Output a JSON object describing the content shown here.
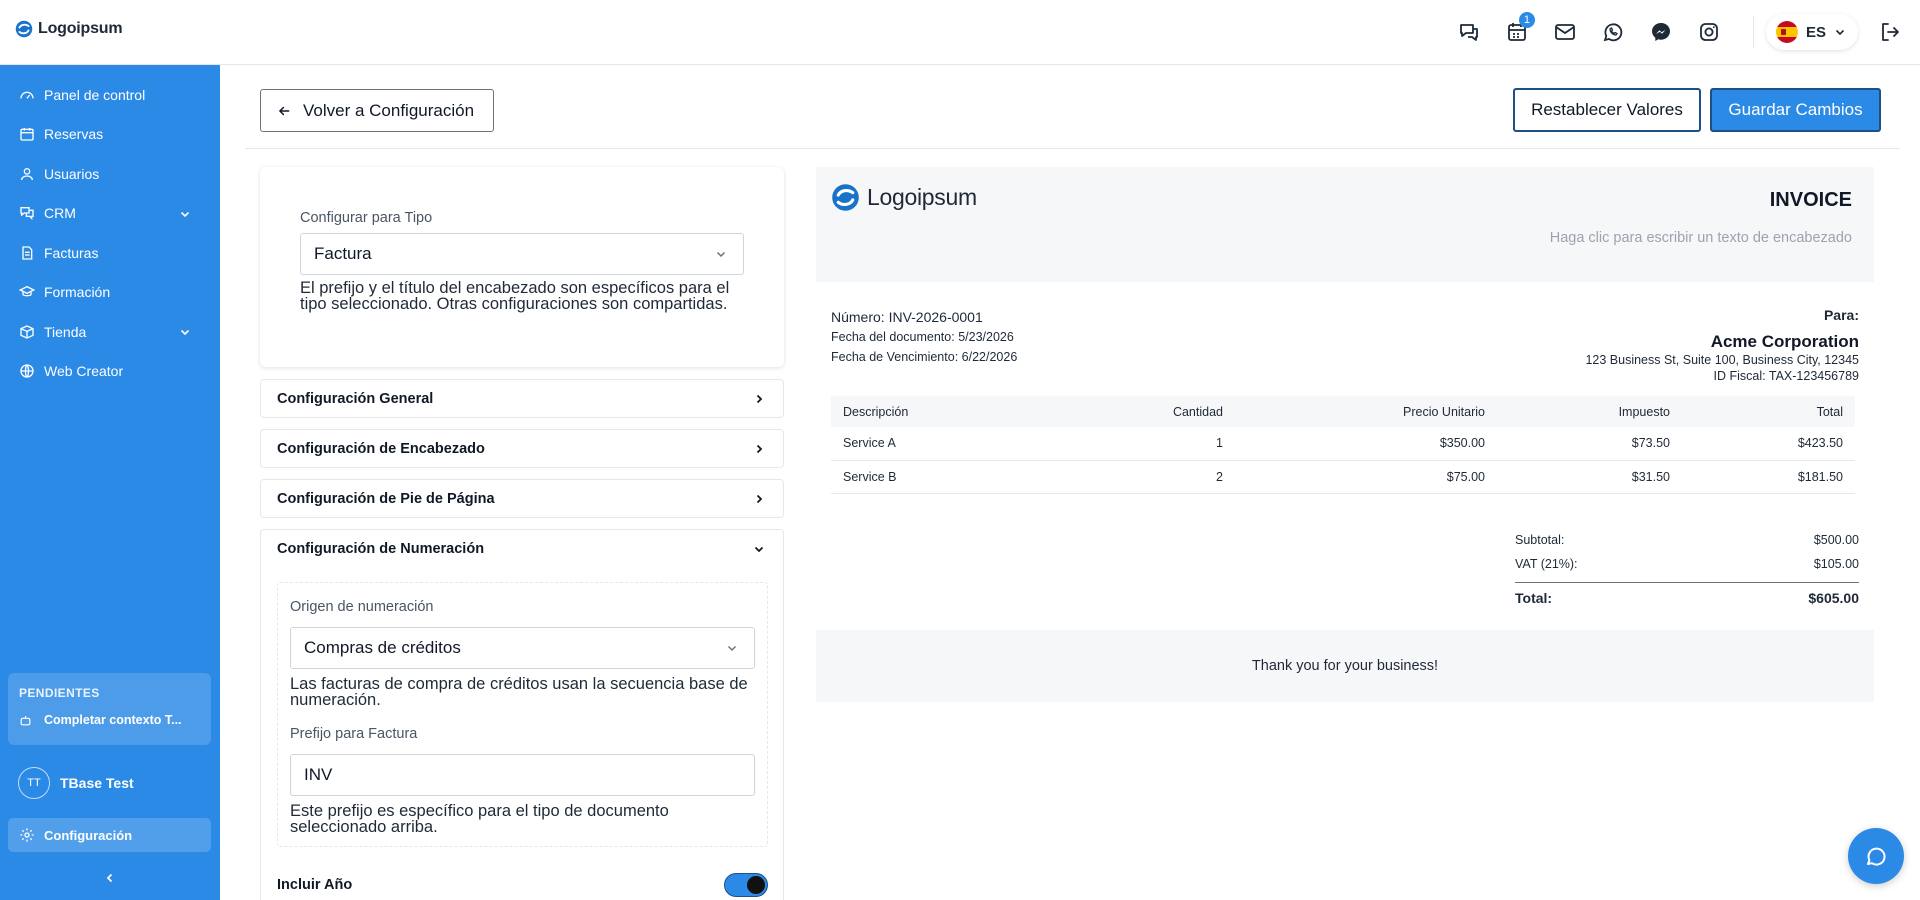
{
  "app": {
    "logo_text": "Logoipsum"
  },
  "topbar": {
    "calendar_badge": "1",
    "language": "ES",
    "icons": [
      "chat-bubbles-icon",
      "calendar-icon",
      "mail-icon",
      "whatsapp-icon",
      "messenger-icon",
      "instagram-icon",
      "logout-icon"
    ]
  },
  "sidebar": {
    "items": [
      {
        "label": "Panel de control",
        "icon": "gauge-icon"
      },
      {
        "label": "Reservas",
        "icon": "calendar-icon"
      },
      {
        "label": "Usuarios",
        "icon": "user-icon"
      },
      {
        "label": "CRM",
        "icon": "chat-icon"
      },
      {
        "label": "Facturas",
        "icon": "document-icon"
      },
      {
        "label": "Formación",
        "icon": "graduation-cap-icon"
      },
      {
        "label": "Tienda",
        "icon": "package-icon"
      },
      {
        "label": "Web Creator",
        "icon": "globe-icon"
      }
    ],
    "pending_title": "PENDIENTES",
    "pending_item": "Completar contexto T...",
    "user_initials": "TT",
    "user_name": "TBase Test",
    "settings_label": "Configuración"
  },
  "toolbar": {
    "back_label": "Volver a Configuración",
    "reset_label": "Restablecer Valores",
    "save_label": "Guardar Cambios"
  },
  "settings": {
    "type_label": "Configurar para Tipo",
    "type_value": "Factura",
    "type_help": "El prefijo y el título del encabezado son específicos para el tipo seleccionado. Otras configuraciones son compartidas.",
    "sections": {
      "general": "Configuración General",
      "header": "Configuración de Encabezado",
      "footer": "Configuración de Pie de Página",
      "numbering": "Configuración de Numeración"
    },
    "numbering": {
      "origin_label": "Origen de numeración",
      "origin_value": "Compras de créditos",
      "origin_help": "Las facturas de compra de créditos usan la secuencia base de numeración.",
      "prefix_label": "Prefijo para Factura",
      "prefix_value": "INV",
      "prefix_help": "Este prefijo es específico para el tipo de documento seleccionado arriba.",
      "include_year_label": "Incluir Año",
      "include_year": true
    }
  },
  "invoice": {
    "logo_text": "Logoipsum",
    "title": "INVOICE",
    "header_placeholder": "Haga clic para escribir un texto de encabezado",
    "number_label": "Número:",
    "number_value": "INV-2026-0001",
    "date_label": "Fecha del documento:",
    "date_value": "5/23/2026",
    "due_label": "Fecha de Vencimiento:",
    "due_value": "6/22/2026",
    "to_label": "Para:",
    "company": "Acme Corporation",
    "address": "123 Business St, Suite 100, Business City, 12345",
    "tax_id": "ID Fiscal: TAX-123456789",
    "columns": [
      "Descripción",
      "Cantidad",
      "Precio Unitario",
      "Impuesto",
      "Total"
    ],
    "rows": [
      [
        "Service A",
        "1",
        "$350.00",
        "$73.50",
        "$423.50"
      ],
      [
        "Service B",
        "2",
        "$75.00",
        "$31.50",
        "$181.50"
      ]
    ],
    "subtotal_label": "Subtotal:",
    "subtotal_value": "$500.00",
    "vat_label": "VAT (21%):",
    "vat_value": "$105.00",
    "total_label": "Total:",
    "total_value": "$605.00",
    "footer_text": "Thank you for your business!"
  }
}
